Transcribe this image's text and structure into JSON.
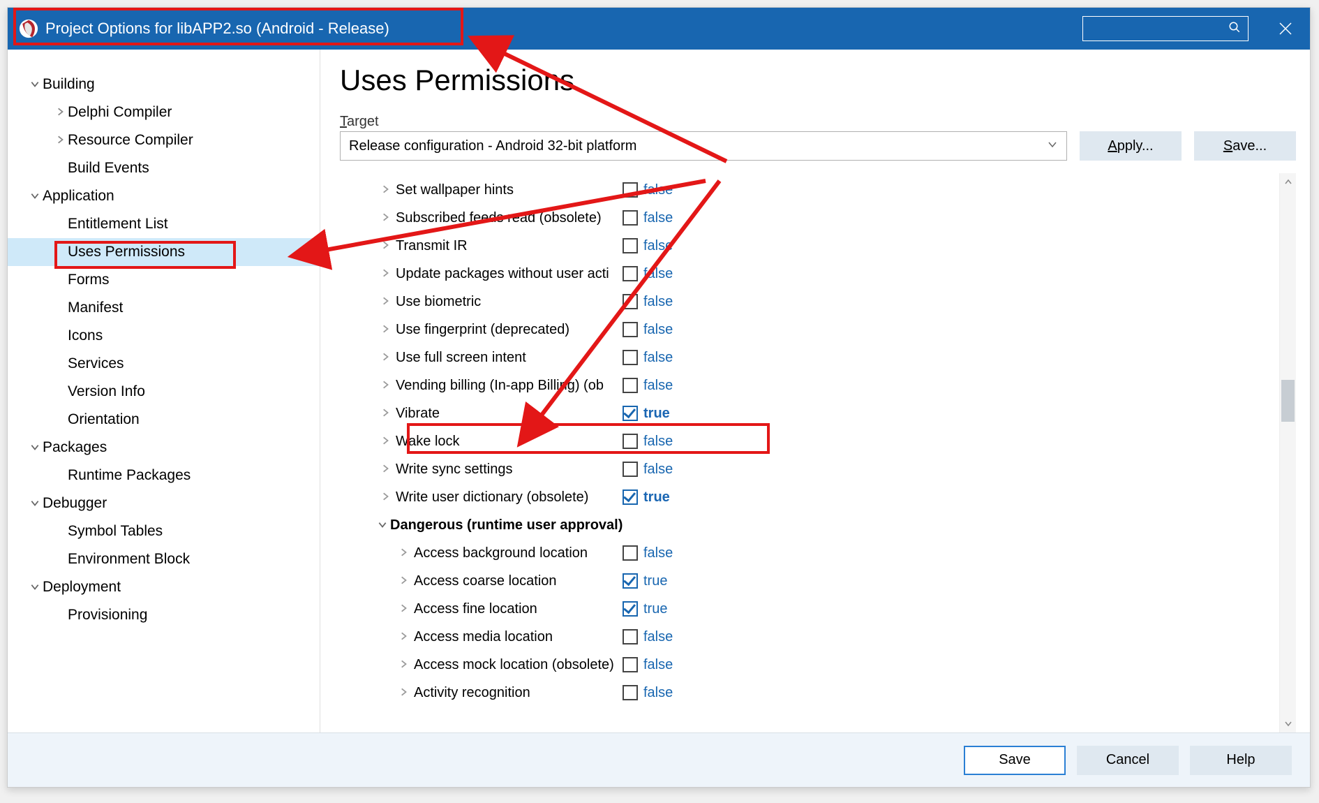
{
  "window": {
    "title": "Project Options for libAPP2.so  (Android - Release)"
  },
  "sidebar": {
    "nodes": [
      {
        "label": "Building",
        "level": 1,
        "expand": "down"
      },
      {
        "label": "Delphi Compiler",
        "level": 2,
        "expand": "right"
      },
      {
        "label": "Resource Compiler",
        "level": 2,
        "expand": "right"
      },
      {
        "label": "Build Events",
        "level": 2,
        "expand": "none"
      },
      {
        "label": "Application",
        "level": 1,
        "expand": "down"
      },
      {
        "label": "Entitlement List",
        "level": 2,
        "expand": "none"
      },
      {
        "label": "Uses Permissions",
        "level": 2,
        "expand": "none",
        "selected": true
      },
      {
        "label": "Forms",
        "level": 2,
        "expand": "none"
      },
      {
        "label": "Manifest",
        "level": 2,
        "expand": "none"
      },
      {
        "label": "Icons",
        "level": 2,
        "expand": "none"
      },
      {
        "label": "Services",
        "level": 2,
        "expand": "none"
      },
      {
        "label": "Version Info",
        "level": 2,
        "expand": "none"
      },
      {
        "label": "Orientation",
        "level": 2,
        "expand": "none"
      },
      {
        "label": "Packages",
        "level": 1,
        "expand": "down"
      },
      {
        "label": "Runtime Packages",
        "level": 2,
        "expand": "none"
      },
      {
        "label": "Debugger",
        "level": 1,
        "expand": "down"
      },
      {
        "label": "Symbol Tables",
        "level": 2,
        "expand": "none"
      },
      {
        "label": "Environment Block",
        "level": 2,
        "expand": "none"
      },
      {
        "label": "Deployment",
        "level": 1,
        "expand": "down"
      },
      {
        "label": "Provisioning",
        "level": 2,
        "expand": "none"
      }
    ]
  },
  "main": {
    "title": "Uses Permissions",
    "target_label_prefix": "T",
    "target_label_rest": "arget",
    "target_value": "Release configuration - Android 32-bit platform",
    "apply_label": "Apply...",
    "save_label": "Save..."
  },
  "permissions": [
    {
      "name": "Set wallpaper hints",
      "checked": false,
      "bold": false,
      "indent": false
    },
    {
      "name": "Subscribed feeds read (obsolete)",
      "checked": false,
      "bold": false,
      "indent": false
    },
    {
      "name": "Transmit IR",
      "checked": false,
      "bold": false,
      "indent": false
    },
    {
      "name": "Update packages without user acti",
      "checked": false,
      "bold": false,
      "indent": false
    },
    {
      "name": "Use biometric",
      "checked": false,
      "bold": false,
      "indent": false
    },
    {
      "name": "Use fingerprint (deprecated)",
      "checked": false,
      "bold": false,
      "indent": false
    },
    {
      "name": "Use full screen intent",
      "checked": false,
      "bold": false,
      "indent": false
    },
    {
      "name": "Vending billing (In-app Billing) (ob",
      "checked": false,
      "bold": false,
      "indent": false
    },
    {
      "name": "Vibrate",
      "checked": true,
      "bold": true,
      "indent": false
    },
    {
      "name": "Wake lock",
      "checked": false,
      "bold": false,
      "indent": false
    },
    {
      "name": "Write sync settings",
      "checked": false,
      "bold": false,
      "indent": false
    },
    {
      "name": "Write user dictionary (obsolete)",
      "checked": true,
      "bold": true,
      "indent": false
    },
    {
      "name": "Dangerous (runtime user approval)",
      "group": true,
      "expand": "down",
      "indent": false
    },
    {
      "name": "Access background location",
      "checked": false,
      "bold": false,
      "indent": true
    },
    {
      "name": "Access coarse location",
      "checked": true,
      "bold": false,
      "indent": true
    },
    {
      "name": "Access fine location",
      "checked": true,
      "bold": false,
      "indent": true
    },
    {
      "name": "Access media location",
      "checked": false,
      "bold": false,
      "indent": true
    },
    {
      "name": "Access mock location (obsolete)",
      "checked": false,
      "bold": false,
      "indent": true
    },
    {
      "name": "Activity recognition",
      "checked": false,
      "bold": false,
      "indent": true
    }
  ],
  "footer": {
    "save": "Save",
    "cancel": "Cancel",
    "help": "Help"
  },
  "value_labels": {
    "true": "true",
    "false": "false"
  }
}
